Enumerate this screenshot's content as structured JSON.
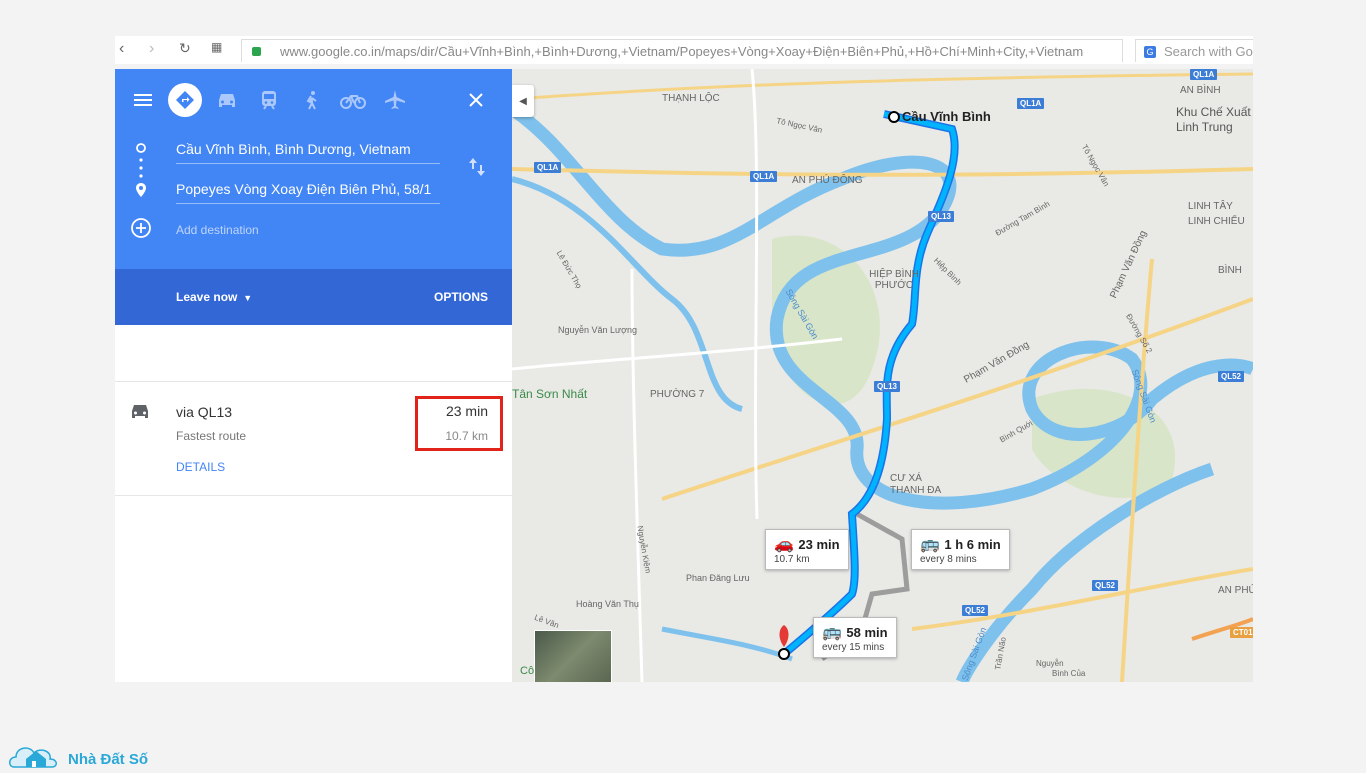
{
  "browser": {
    "url": "www.google.co.in/maps/dir/Cầu+Vĩnh+Bình,+Bình+Dương,+Vietnam/Popeyes+Vòng+Xoay+Điện+Biên+Phủ,+Hồ+Chí+Minh+City,+Vietnam",
    "search_placeholder": "Search with Goo"
  },
  "directions": {
    "origin": "Cầu Vĩnh Bình, Bình Dương, Vietnam",
    "destination": "Popeyes Vòng Xoay Điện Biên Phủ, 58/1",
    "add_destination": "Add destination",
    "leave_now": "Leave now",
    "options": "OPTIONS"
  },
  "route": {
    "via": "via QL13",
    "subtitle": "Fastest route",
    "time": "23 min",
    "distance": "10.7 km",
    "details": "DETAILS"
  },
  "map": {
    "start_label": "Cầu Vĩnh Bình",
    "callouts": [
      {
        "big": "23 min",
        "small": "10.7 km"
      },
      {
        "big": "1 h 6 min",
        "small": "every 8 mins"
      },
      {
        "big": "58 min",
        "small": "every 15 mins"
      }
    ],
    "labels": [
      "THẠNH LỘC",
      "Tô Ngọc Vân",
      "AN PHÚ ĐÔNG",
      "AN BÌNH",
      "Khu Chế Xuất Linh Trung",
      "Tô Ngọc Vân",
      "Đường Tam Bình",
      "LINH TÂY",
      "LINH CHIỂU",
      "BÌNH",
      "HIỆP BÌNH PHƯỚC",
      "Hiệp Bình",
      "Lê Đức Thọ",
      "Sông Sài Gòn",
      "Nguyễn Văn Lượng",
      "Phạm Văn Đồng",
      "Phạm Văn Đồng",
      "Đường Số 2",
      "Tân Sơn Nhất",
      "PHƯỜNG 7",
      "Sông Sài Gòn",
      "Bình Quới",
      "CƯ XÁ THANH ĐA",
      "Nguyễn Kiệm",
      "Phan Đăng Lưu",
      "Hoàng Văn Thụ",
      "AN PHÚ",
      "Sông Sài Gòn",
      "Trần Não",
      "Lê Văn",
      "Nguyễn",
      "Bình Của",
      "Cô"
    ],
    "shields": [
      "QL1A",
      "QL1A",
      "QL1A",
      "QL1A",
      "QL13",
      "QL13",
      "QL52",
      "QL52",
      "QL52",
      "CT01"
    ]
  },
  "logo": {
    "text": "Nhà Đất Số"
  }
}
